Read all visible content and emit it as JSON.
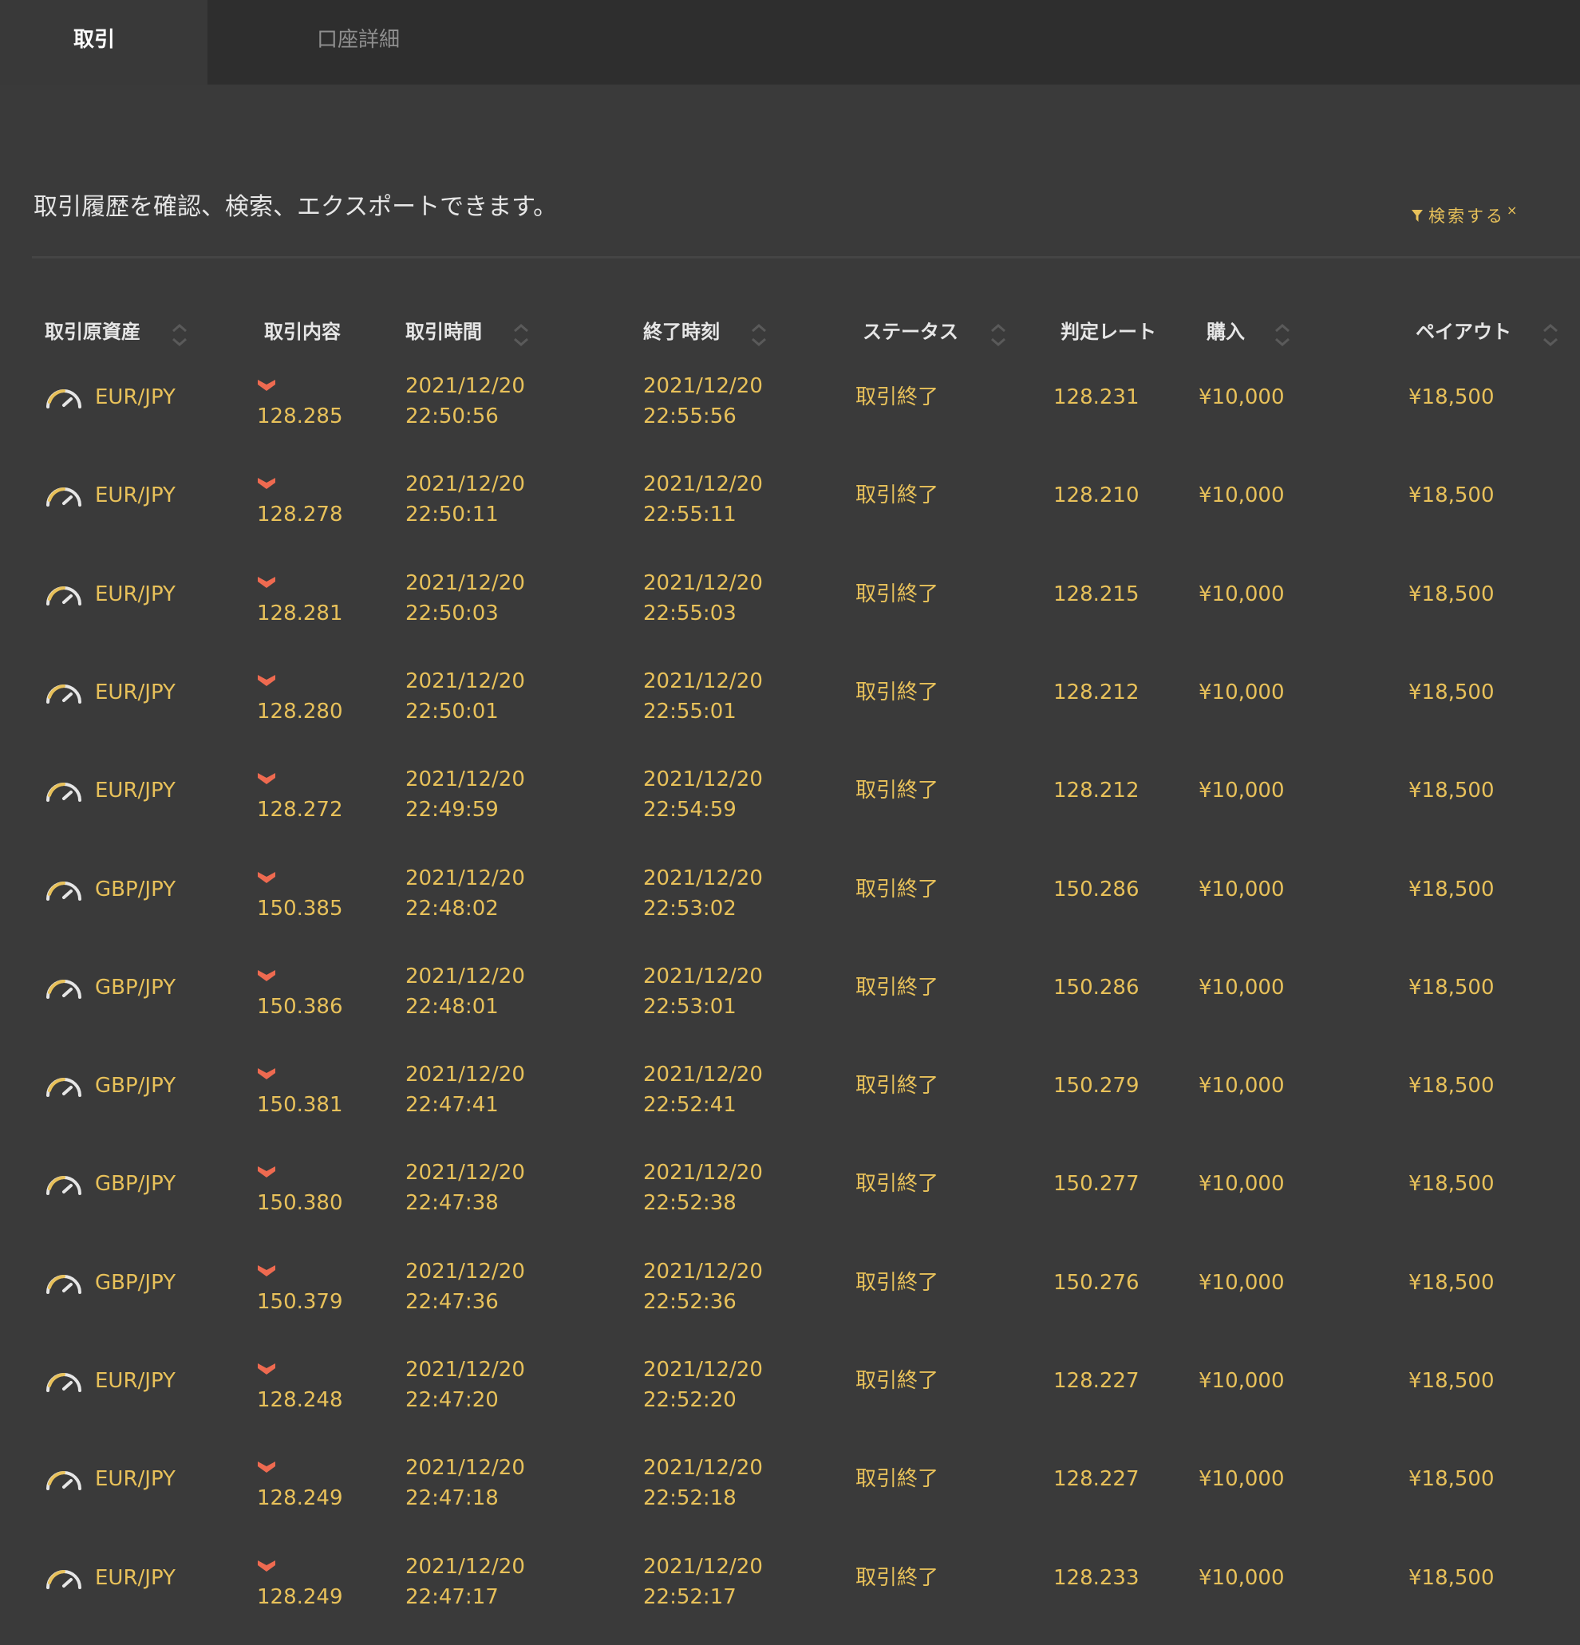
{
  "tabs": [
    {
      "label": "取引"
    },
    {
      "label": "口座詳細"
    }
  ],
  "description": "取引履歴を確認、検索、エクスポートできます。",
  "search": {
    "label": "検索する",
    "clear": "×"
  },
  "columns": {
    "asset": "取引原資産",
    "content": "取引内容",
    "trade_time": "取引時間",
    "end_time": "終了時刻",
    "status": "ステータス",
    "rate": "判定レート",
    "buy": "購入",
    "payout": "ペイアウト"
  },
  "colors": {
    "accent": "#e8c15a",
    "direction_down": "#ee6a50",
    "background": "#3a3a3a",
    "tabbar": "#2e2e2e"
  },
  "rows": [
    {
      "asset": "EUR/JPY",
      "direction": "down",
      "open": "128.285",
      "trade_date": "2021/12/20",
      "trade_time": "22:50:56",
      "end_date": "2021/12/20",
      "end_time": "22:55:56",
      "status": "取引終了",
      "rate": "128.231",
      "buy": "¥10,000",
      "payout": "¥18,500"
    },
    {
      "asset": "EUR/JPY",
      "direction": "down",
      "open": "128.278",
      "trade_date": "2021/12/20",
      "trade_time": "22:50:11",
      "end_date": "2021/12/20",
      "end_time": "22:55:11",
      "status": "取引終了",
      "rate": "128.210",
      "buy": "¥10,000",
      "payout": "¥18,500"
    },
    {
      "asset": "EUR/JPY",
      "direction": "down",
      "open": "128.281",
      "trade_date": "2021/12/20",
      "trade_time": "22:50:03",
      "end_date": "2021/12/20",
      "end_time": "22:55:03",
      "status": "取引終了",
      "rate": "128.215",
      "buy": "¥10,000",
      "payout": "¥18,500"
    },
    {
      "asset": "EUR/JPY",
      "direction": "down",
      "open": "128.280",
      "trade_date": "2021/12/20",
      "trade_time": "22:50:01",
      "end_date": "2021/12/20",
      "end_time": "22:55:01",
      "status": "取引終了",
      "rate": "128.212",
      "buy": "¥10,000",
      "payout": "¥18,500"
    },
    {
      "asset": "EUR/JPY",
      "direction": "down",
      "open": "128.272",
      "trade_date": "2021/12/20",
      "trade_time": "22:49:59",
      "end_date": "2021/12/20",
      "end_time": "22:54:59",
      "status": "取引終了",
      "rate": "128.212",
      "buy": "¥10,000",
      "payout": "¥18,500"
    },
    {
      "asset": "GBP/JPY",
      "direction": "down",
      "open": "150.385",
      "trade_date": "2021/12/20",
      "trade_time": "22:48:02",
      "end_date": "2021/12/20",
      "end_time": "22:53:02",
      "status": "取引終了",
      "rate": "150.286",
      "buy": "¥10,000",
      "payout": "¥18,500"
    },
    {
      "asset": "GBP/JPY",
      "direction": "down",
      "open": "150.386",
      "trade_date": "2021/12/20",
      "trade_time": "22:48:01",
      "end_date": "2021/12/20",
      "end_time": "22:53:01",
      "status": "取引終了",
      "rate": "150.286",
      "buy": "¥10,000",
      "payout": "¥18,500"
    },
    {
      "asset": "GBP/JPY",
      "direction": "down",
      "open": "150.381",
      "trade_date": "2021/12/20",
      "trade_time": "22:47:41",
      "end_date": "2021/12/20",
      "end_time": "22:52:41",
      "status": "取引終了",
      "rate": "150.279",
      "buy": "¥10,000",
      "payout": "¥18,500"
    },
    {
      "asset": "GBP/JPY",
      "direction": "down",
      "open": "150.380",
      "trade_date": "2021/12/20",
      "trade_time": "22:47:38",
      "end_date": "2021/12/20",
      "end_time": "22:52:38",
      "status": "取引終了",
      "rate": "150.277",
      "buy": "¥10,000",
      "payout": "¥18,500"
    },
    {
      "asset": "GBP/JPY",
      "direction": "down",
      "open": "150.379",
      "trade_date": "2021/12/20",
      "trade_time": "22:47:36",
      "end_date": "2021/12/20",
      "end_time": "22:52:36",
      "status": "取引終了",
      "rate": "150.276",
      "buy": "¥10,000",
      "payout": "¥18,500"
    },
    {
      "asset": "EUR/JPY",
      "direction": "down",
      "open": "128.248",
      "trade_date": "2021/12/20",
      "trade_time": "22:47:20",
      "end_date": "2021/12/20",
      "end_time": "22:52:20",
      "status": "取引終了",
      "rate": "128.227",
      "buy": "¥10,000",
      "payout": "¥18,500"
    },
    {
      "asset": "EUR/JPY",
      "direction": "down",
      "open": "128.249",
      "trade_date": "2021/12/20",
      "trade_time": "22:47:18",
      "end_date": "2021/12/20",
      "end_time": "22:52:18",
      "status": "取引終了",
      "rate": "128.227",
      "buy": "¥10,000",
      "payout": "¥18,500"
    },
    {
      "asset": "EUR/JPY",
      "direction": "down",
      "open": "128.249",
      "trade_date": "2021/12/20",
      "trade_time": "22:47:17",
      "end_date": "2021/12/20",
      "end_time": "22:52:17",
      "status": "取引終了",
      "rate": "128.233",
      "buy": "¥10,000",
      "payout": "¥18,500"
    }
  ]
}
